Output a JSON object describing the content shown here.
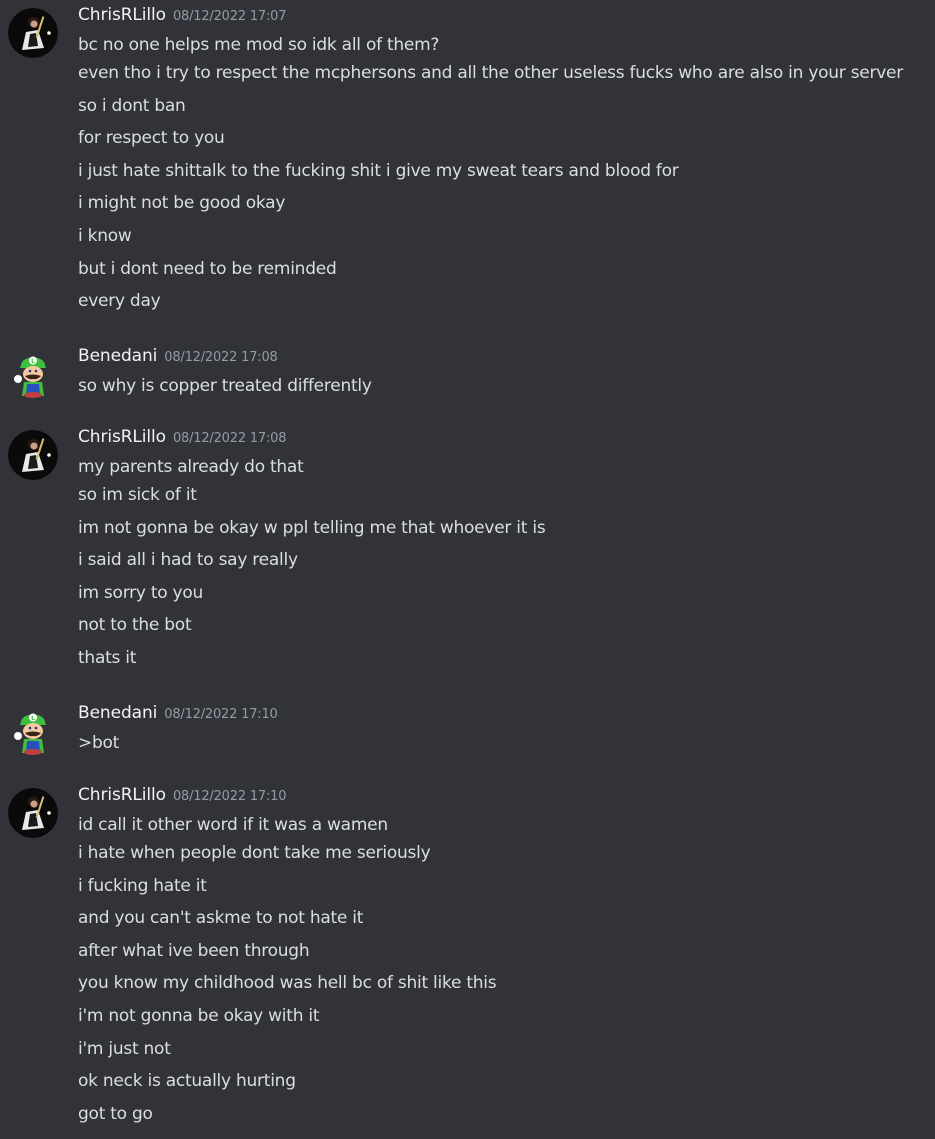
{
  "colors": {
    "background": "#313338",
    "username": "#f2f3f5",
    "timestamp": "#949ba4",
    "message_text": "#dbdee1"
  },
  "groups": [
    {
      "username": "ChrisRLillo",
      "timestamp": "08/12/2022 17:07",
      "avatar_icon": "guitar-player-avatar-icon",
      "messages": [
        "bc no one helps me mod so idk all of them?",
        "even tho i try to respect the mcphersons and all the other useless fucks who are also in your server",
        "so i dont ban",
        "for respect to you",
        "i just hate shittalk to the fucking shit i give my sweat tears and blood for",
        "i might not be good okay",
        "i know",
        "but i dont need to be reminded",
        "every day"
      ]
    },
    {
      "username": "Benedani",
      "timestamp": "08/12/2022 17:08",
      "avatar_icon": "green-plumber-avatar-icon",
      "messages": [
        "so why is copper treated differently"
      ]
    },
    {
      "username": "ChrisRLillo",
      "timestamp": "08/12/2022 17:08",
      "avatar_icon": "guitar-player-avatar-icon",
      "messages": [
        "my parents already do that",
        "so im sick of it",
        "im not gonna be okay w ppl telling me that whoever it is",
        "i said all i had to say really",
        "im sorry to you",
        "not to the bot",
        "thats it"
      ]
    },
    {
      "username": "Benedani",
      "timestamp": "08/12/2022 17:10",
      "avatar_icon": "green-plumber-avatar-icon",
      "messages": [
        ">bot"
      ]
    },
    {
      "username": "ChrisRLillo",
      "timestamp": "08/12/2022 17:10",
      "avatar_icon": "guitar-player-avatar-icon",
      "messages": [
        "id call it other word if it was a wamen",
        "i hate when people dont take me seriously",
        "i fucking hate it",
        "and you can't askme to not hate it",
        "after what ive been through",
        "you know my childhood was hell bc of shit like this",
        "i'm not gonna be okay with it",
        "i'm just not",
        "ok neck is actually hurting",
        "got to go"
      ]
    }
  ]
}
